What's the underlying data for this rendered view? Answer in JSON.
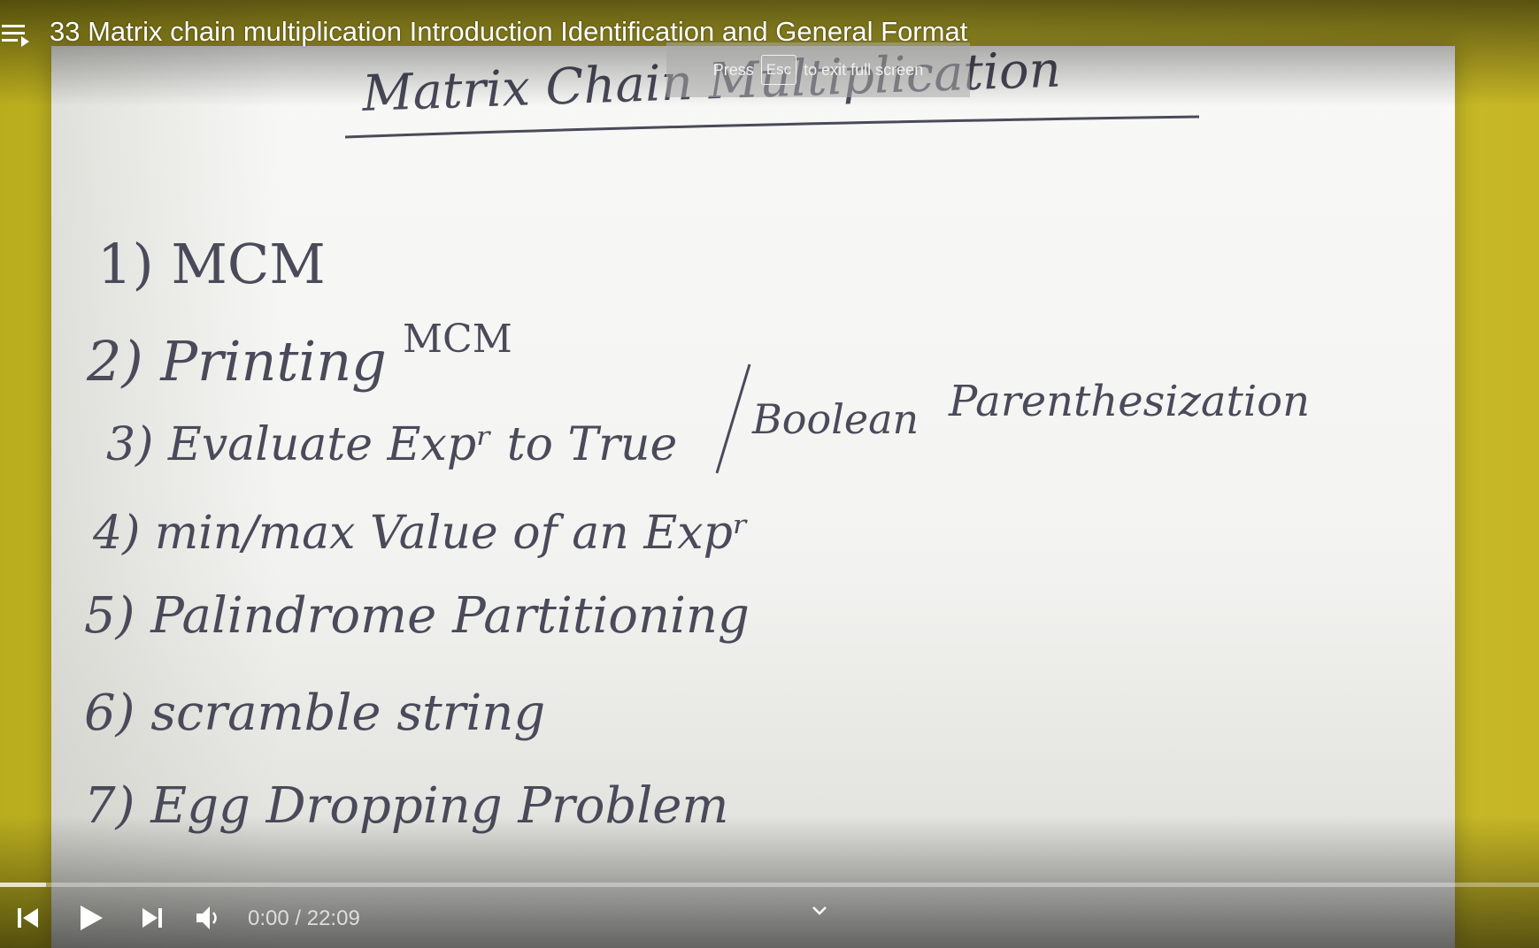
{
  "video": {
    "title": "33 Matrix chain multiplication Introduction Identification and General Format"
  },
  "toast": {
    "press": "Press",
    "key": "Esc",
    "rest": "to exit full screen"
  },
  "player": {
    "current_time": "0:00",
    "duration": "22:09",
    "time_separator": " / ",
    "progress_played": 0.0,
    "progress_buffered": 0.03
  },
  "icons": {
    "playlist": "playlist-icon",
    "previous": "previous-icon",
    "play": "play-icon",
    "next": "next-icon",
    "volume": "volume-icon",
    "chevron": "chevron-down-icon"
  },
  "colors": {
    "progress_played": "#ff0000",
    "background": "#cdbf2a"
  }
}
